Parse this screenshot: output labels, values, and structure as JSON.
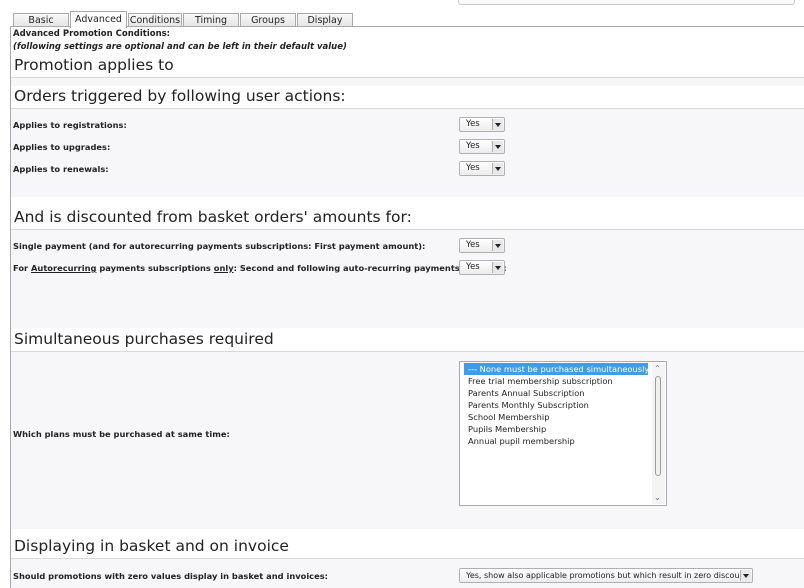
{
  "tabs": [
    {
      "label": "Basic"
    },
    {
      "label": "Advanced"
    },
    {
      "label": "Conditions"
    },
    {
      "label": "Timing"
    },
    {
      "label": "Groups"
    },
    {
      "label": "Display"
    }
  ],
  "header": {
    "title": "Advanced Promotion Conditions:",
    "note": "(following settings are optional and can be left in their default value)"
  },
  "sections": {
    "applies": "Promotion applies to",
    "orders": "Orders triggered by following user actions:",
    "discounted": "And is discounted from basket orders' amounts for:",
    "simultaneous": "Simultaneous purchases required",
    "displaying": "Displaying in basket and on invoice"
  },
  "rows": {
    "registrations": {
      "label": "Applies to registrations:",
      "value": "Yes"
    },
    "upgrades": {
      "label": "Applies to upgrades:",
      "value": "Yes"
    },
    "renewals": {
      "label": "Applies to renewals:",
      "value": "Yes"
    },
    "single_payment": {
      "label": "Single payment (and for autorecurring payments subscriptions: First payment amount):",
      "value": "Yes"
    },
    "recurring": {
      "label_pre": "For ",
      "label_u1": "Autorecurring",
      "label_mid": " payments subscriptions ",
      "label_u2": "only",
      "label_post": ": Second and following auto-recurring payments amounts:",
      "value": "Yes"
    },
    "plans": {
      "label": "Which plans must be purchased at same time:"
    },
    "zero_values": {
      "label": "Should promotions with zero values display in basket and invoices:",
      "value": "Yes, show also applicable promotions but which result in zero discount"
    }
  },
  "plans_list": [
    "--- None must be purchased simultaneously ---",
    "Free trial membership subscription",
    "Parents Annual Subscription",
    "Parents Monthly Subscription",
    "School Membership",
    "Pupils Membership",
    "Annual pupil membership"
  ]
}
